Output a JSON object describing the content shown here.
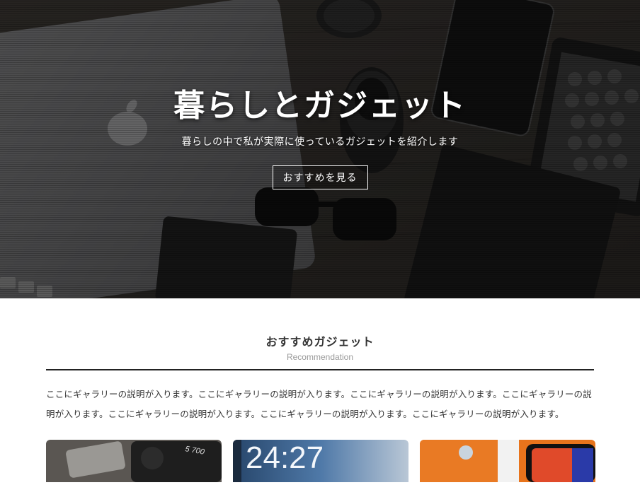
{
  "hero": {
    "title": "暮らしとガジェット",
    "subtitle": "暮らしの中で私が実際に使っているガジェットを紹介します",
    "button_label": "おすすめを見る"
  },
  "recommendation": {
    "title": "おすすめガジェット",
    "subtitle": "Recommendation",
    "description": "ここにギャラリーの説明が入ります。ここにギャラリーの説明が入ります。ここにギャラリーの説明が入ります。ここにギャラリーの説明が入ります。ここにギャラリーの説明が入ります。ここにギャラリーの説明が入ります。ここにギャラリーの説明が入ります。",
    "cards": [
      {
        "image": "camera-photo",
        "visible_text": "5 700"
      },
      {
        "image": "lockscreen-phone-photo",
        "visible_text": "24:27"
      },
      {
        "image": "smartphones-photo",
        "visible_text": ""
      }
    ]
  },
  "colors": {
    "hero_overlay": "#1e1c1a",
    "text_primary": "#333333",
    "text_muted": "#999999",
    "rule": "#222222",
    "white": "#ffffff"
  }
}
